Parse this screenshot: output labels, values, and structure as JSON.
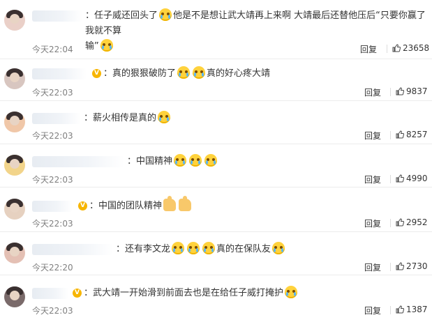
{
  "comments": [
    {
      "text": "：任子威还回头了[泪]他是不是想让武大靖再上来啊 大靖最后还替他压后“只要你赢了我就不算输”[泪]",
      "segments": [
        {
          "t": "：任子威还回头了"
        },
        {
          "e": "emoji"
        },
        {
          "t": "他是不是想让武大靖再上来啊 大靖最后还替他压后“只要你赢了我就不算"
        }
      ],
      "line2": "输”",
      "time": "今天22:04",
      "reply": "回复",
      "likes": "23658"
    },
    {
      "segments": [
        {
          "t": "：真的狠狠破防了"
        },
        {
          "e": "emoji"
        },
        {
          "e": "emoji"
        },
        {
          "t": "真的好心疼大靖"
        }
      ],
      "time": "今天22:03",
      "reply": "回复",
      "likes": "9837"
    },
    {
      "segments": [
        {
          "t": "：薪火相传是真的"
        },
        {
          "e": "emoji"
        }
      ],
      "time": "今天22:03",
      "reply": "回复",
      "likes": "8257"
    },
    {
      "segments": [
        {
          "t": "：中国精神"
        },
        {
          "e": "emoji"
        },
        {
          "e": "emoji"
        },
        {
          "e": "emoji"
        }
      ],
      "time": "今天22:03",
      "reply": "回复",
      "likes": "4990"
    },
    {
      "segments": [
        {
          "t": "：中国的团队精神"
        },
        {
          "e": "thumb"
        },
        {
          "e": "thumb"
        }
      ],
      "time": "今天22:03",
      "reply": "回复",
      "likes": "2952"
    },
    {
      "segments": [
        {
          "t": "：还有李文龙"
        },
        {
          "e": "emoji"
        },
        {
          "e": "emoji"
        },
        {
          "e": "emoji"
        },
        {
          "t": "真的在保队友"
        },
        {
          "e": "emoji"
        }
      ],
      "time": "今天22:20",
      "reply": "回复",
      "likes": "2730"
    },
    {
      "segments": [
        {
          "t": "：武大靖一开始滑到前面去也是在给任子威打掩护"
        },
        {
          "e": "emoji"
        }
      ],
      "time": "今天22:03",
      "reply": "回复",
      "likes": "1387"
    }
  ],
  "colors": {
    "vip_badge": "#f7b500",
    "time": "#808080",
    "divider": "#ececec"
  }
}
